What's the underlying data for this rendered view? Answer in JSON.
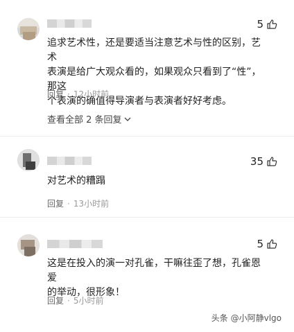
{
  "comments": [
    {
      "likes": "5",
      "text": "追求艺术性，还是要适当注意艺术与性的区别，艺术\n表演是给广大观众看的，如果观众只看到了“性”，那这\n个表演的确值得导演者与表演者好好考虑。",
      "reply_label": "回复",
      "time": "12小时前",
      "view_replies": "查看全部 2 条回复"
    },
    {
      "likes": "35",
      "text": "对艺术的糟蹋",
      "reply_label": "回复",
      "time": "13小时前"
    },
    {
      "likes": "5",
      "text": "这是在投入的演一对孔雀，干嘛往歪了想，孔雀恩爱\n的举动，很形象！",
      "reply_label": "回复",
      "time": "5小时前"
    }
  ],
  "watermark": "头条 @小阿静vlgo",
  "icons": {
    "like": "thumbs-up-icon",
    "expand": "chevron-down-icon"
  }
}
